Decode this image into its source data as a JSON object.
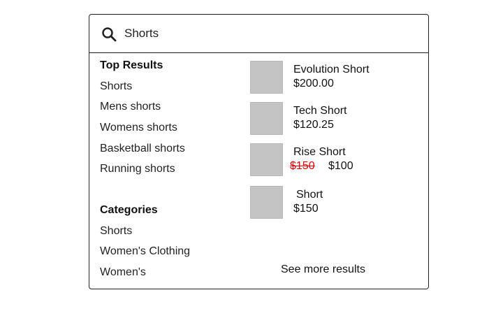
{
  "search": {
    "value": "Shorts",
    "icon": "search-icon"
  },
  "top_results": {
    "heading": "Top Results",
    "items": [
      "Shorts",
      "Mens shorts",
      "Womens shorts",
      "Basketball shorts",
      "Running shorts"
    ]
  },
  "categories": {
    "heading": "Categories",
    "items": [
      "Shorts",
      "Women's Clothing",
      "Women's"
    ]
  },
  "products": [
    {
      "name": "Evolution Short",
      "price": "$200.00"
    },
    {
      "name": "Tech Short",
      "price": "$120.25"
    },
    {
      "name": "Rise Short",
      "old_price": "$150",
      "price": "$100"
    },
    {
      "name": "Short",
      "price": "$150"
    }
  ],
  "see_more_label": "See more results",
  "colors": {
    "strikethrough_price": "#e00000",
    "thumbnail": "#c4c4c4",
    "border": "#222222"
  }
}
